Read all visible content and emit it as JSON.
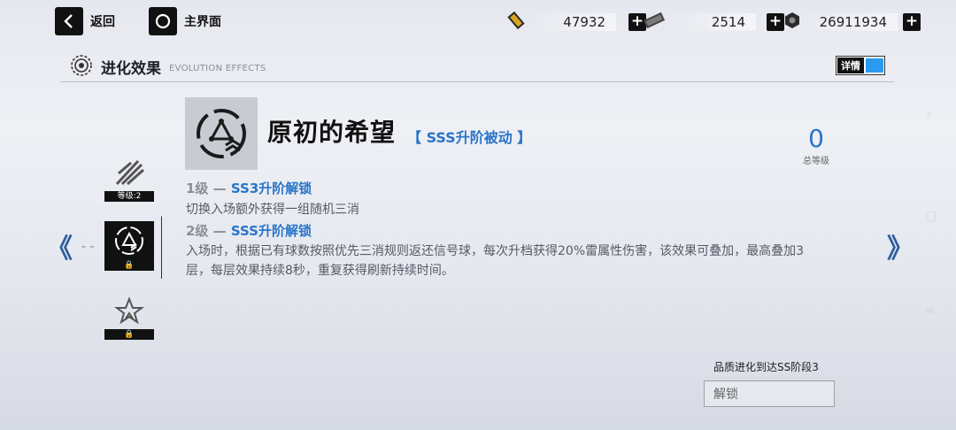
{
  "topbar": {
    "back_label": "返回",
    "home_label": "主界面",
    "resources": [
      {
        "icon": "ticket-icon",
        "value": "47932"
      },
      {
        "icon": "chip-icon",
        "value": "2514"
      },
      {
        "icon": "coin-icon",
        "value": "26911934"
      }
    ]
  },
  "section": {
    "title": "进化效果",
    "subtitle": "EVOLUTION EFFECTS",
    "detail_label": "详情"
  },
  "cards": [
    {
      "icon": "claw-strike-icon",
      "footer": "等级:2"
    },
    {
      "icon": "triangle-orbit-icon",
      "footer": "🔒",
      "selected": true
    },
    {
      "icon": "star-burst-icon",
      "footer": "🔒"
    }
  ],
  "skill": {
    "name": "原初的希望",
    "tag": "【 SSS升阶被动 】",
    "levels": [
      {
        "prefix": "1级 — ",
        "name": "SS3升阶解锁",
        "desc": "切换入场额外获得一组随机三消"
      },
      {
        "prefix": "2级 — ",
        "name": "SSS升阶解锁",
        "desc": "入场时，根据已有球数按照优先三消规则返还信号球，每次升档获得20%雷属性伤害，该效果可叠加，最高叠加3层，每层效果持续8秒，重复获得刷新持续时间。"
      }
    ]
  },
  "total": {
    "value": "0",
    "label": "总等级"
  },
  "requirement": "品质进化到达SS阶段3",
  "unlock_label": "解锁",
  "nav": {
    "prev": "《",
    "next": "》"
  },
  "colors": {
    "accent": "#2a74c9",
    "switch": "#2a9af0"
  }
}
